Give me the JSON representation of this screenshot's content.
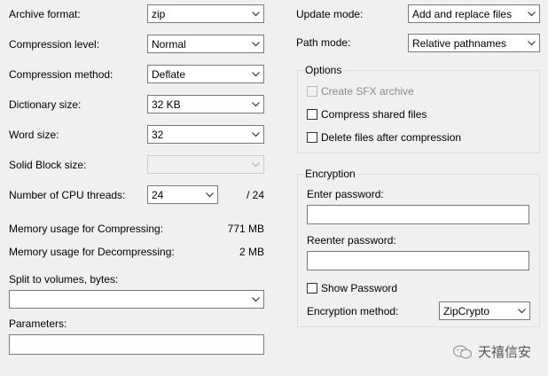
{
  "left": {
    "archive_format": {
      "label": "Archive format:",
      "value": "zip"
    },
    "compression_level": {
      "label": "Compression level:",
      "value": "Normal"
    },
    "compression_method": {
      "label": "Compression method:",
      "value": "Deflate"
    },
    "dictionary_size": {
      "label": "Dictionary size:",
      "value": "32 KB"
    },
    "word_size": {
      "label": "Word size:",
      "value": "32"
    },
    "solid_block_size": {
      "label": "Solid Block size:",
      "value": ""
    },
    "cpu_threads": {
      "label": "Number of CPU threads:",
      "value": "24",
      "max": "/ 24"
    },
    "mem_compress": {
      "label": "Memory usage for Compressing:",
      "value": "771 MB"
    },
    "mem_decompress": {
      "label": "Memory usage for Decompressing:",
      "value": "2 MB"
    },
    "split_volumes": {
      "label": "Split to volumes, bytes:",
      "value": ""
    },
    "parameters": {
      "label": "Parameters:",
      "value": ""
    }
  },
  "right": {
    "update_mode": {
      "label": "Update mode:",
      "value": "Add and replace files"
    },
    "path_mode": {
      "label": "Path mode:",
      "value": "Relative pathnames"
    },
    "options": {
      "title": "Options",
      "create_sfx": "Create SFX archive",
      "compress_shared": "Compress shared files",
      "delete_after": "Delete files after compression"
    },
    "encryption": {
      "title": "Encryption",
      "enter_password": "Enter password:",
      "reenter_password": "Reenter password:",
      "show_password": "Show Password",
      "method_label": "Encryption method:",
      "method_value": "ZipCrypto"
    }
  },
  "watermark": {
    "text": "天禧信安"
  },
  "icons": {
    "dropdown": "chevron-down-icon",
    "checkbox": "checkbox-icon",
    "watermark": "wechat-icon"
  },
  "colors": {
    "background": "#f0f0f0",
    "field_border": "#7a7a7a",
    "disabled_text": "#8a8a8a"
  }
}
